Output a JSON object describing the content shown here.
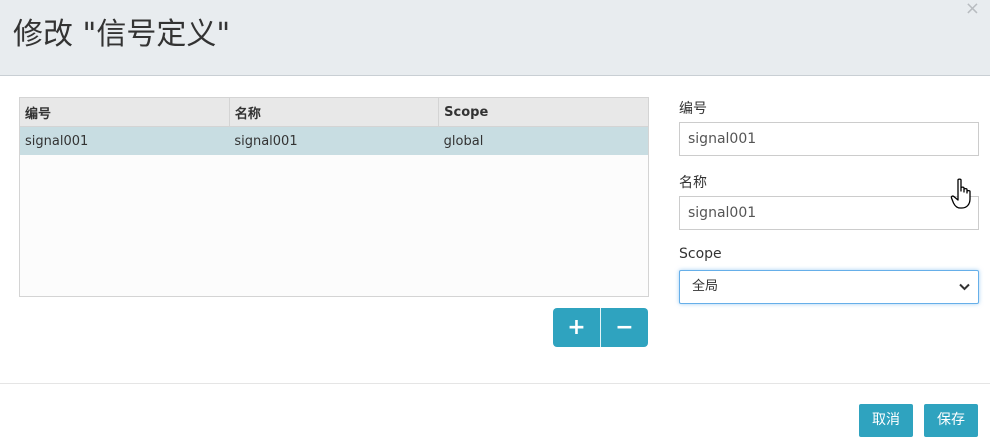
{
  "dialog": {
    "title": "修改 \"信号定义\"",
    "close_symbol": "×"
  },
  "table": {
    "columns": [
      "编号",
      "名称",
      "Scope"
    ],
    "rows": [
      {
        "id": "signal001",
        "name": "signal001",
        "scope": "global"
      }
    ]
  },
  "table_buttons": {
    "add_label": "+",
    "remove_label": "−"
  },
  "form": {
    "id_label": "编号",
    "id_value": "signal001",
    "name_label": "名称",
    "name_value": "signal001",
    "scope_label": "Scope",
    "scope_value": "全局"
  },
  "footer": {
    "cancel_label": "取消",
    "save_label": "保存"
  },
  "colors": {
    "accent": "#2fa3bf",
    "selected_row": "#c8dde2",
    "header_bg": "#e8ecef"
  }
}
